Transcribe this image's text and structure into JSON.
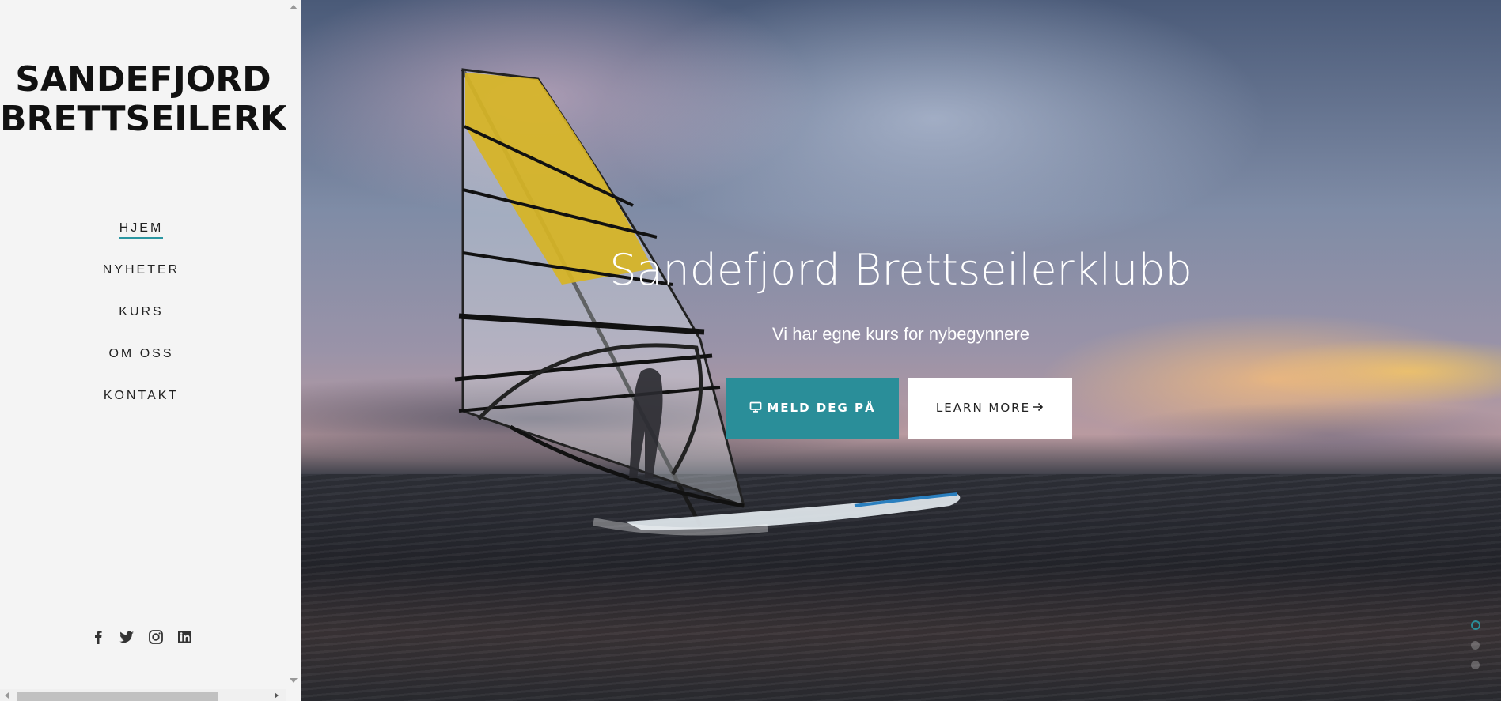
{
  "brand": {
    "line1": "SANDEFJORD",
    "line2": "BRETTSEILERKLUBB"
  },
  "nav": {
    "items": [
      {
        "label": "HJEM",
        "active": true
      },
      {
        "label": "NYHETER",
        "active": false
      },
      {
        "label": "KURS",
        "active": false
      },
      {
        "label": "OM OSS",
        "active": false
      },
      {
        "label": "KONTAKT",
        "active": false
      }
    ]
  },
  "social": {
    "icons": [
      "facebook-icon",
      "twitter-icon",
      "instagram-icon",
      "linkedin-icon"
    ]
  },
  "hero": {
    "title": "Sandefjord Brettseilerklubb",
    "subtitle": "Vi har egne kurs for nybegynnere",
    "primary_button": "MELD DEG PÅ",
    "secondary_button": "LEARN MORE",
    "slides": 3,
    "active_slide": 1
  },
  "colors": {
    "accent": "#2a8e99",
    "sidebar_bg": "#f4f4f4",
    "text": "#111111"
  }
}
